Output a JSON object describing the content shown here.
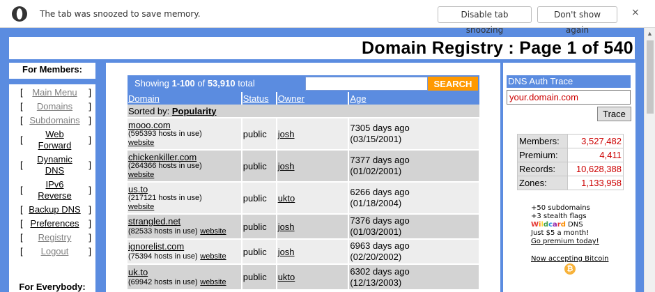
{
  "snooze_bar": {
    "message": "The tab was snoozed to save memory.",
    "disable_label": "Disable tab snoozing",
    "dont_show_label": "Don't show again",
    "close_glyph": "×"
  },
  "header": {
    "title": "Domain Registry : Page 1 of 540"
  },
  "sidebar": {
    "members_title": "For Members:",
    "everybody_title": "For Everybody:",
    "items": [
      {
        "label": "Main Menu"
      },
      {
        "label": "Domains"
      },
      {
        "label": "Subdomains"
      },
      {
        "label": "Web Forward"
      },
      {
        "label": "Dynamic DNS"
      },
      {
        "label": "IPv6 Reverse"
      },
      {
        "label": "Backup DNS"
      },
      {
        "label": "Preferences"
      },
      {
        "label": "Registry"
      },
      {
        "label": "Logout"
      }
    ]
  },
  "registry": {
    "showing_prefix": "Showing ",
    "range": "1-100",
    "of_label": " of ",
    "total": "53,910",
    "total_suffix": " total",
    "search_label": "SEARCH",
    "columns": [
      "Domain",
      "Status",
      "Owner",
      "Age"
    ],
    "sorted_by_label": "Sorted by: ",
    "sorted_by_value": "Popularity",
    "rows": [
      {
        "domain": "mooo.com",
        "hosts": "(595393 hosts in use)",
        "website": "website",
        "status": "public",
        "owner": "josh",
        "age": "7305 days ago",
        "date": "(03/15/2001)"
      },
      {
        "domain": "chickenkiller.com",
        "hosts": "(264366 hosts in use)",
        "website": "website",
        "status": "public",
        "owner": "josh",
        "age": "7377 days ago",
        "date": "(01/02/2001)"
      },
      {
        "domain": "us.to",
        "hosts": "(217121 hosts in use)",
        "website": "website",
        "status": "public",
        "owner": "ukto",
        "age": "6266 days ago",
        "date": "(01/18/2004)"
      },
      {
        "domain": "strangled.net",
        "hosts": "(82533 hosts in use)",
        "website": "website",
        "status": "public",
        "owner": "josh",
        "age": "7376 days ago",
        "date": "(01/03/2001)"
      },
      {
        "domain": "ignorelist.com",
        "hosts": "(75394 hosts in use)",
        "website": "website",
        "status": "public",
        "owner": "josh",
        "age": "6963 days ago",
        "date": "(02/20/2002)"
      },
      {
        "domain": "uk.to",
        "hosts": "(69942 hosts in use)",
        "website": "website",
        "status": "public",
        "owner": "ukto",
        "age": "6302 days ago",
        "date": "(12/13/2003)"
      }
    ]
  },
  "dns_trace": {
    "title": "DNS Auth Trace",
    "input_value": "your.domain.com",
    "button_label": "Trace"
  },
  "stats": [
    {
      "label": "Members:",
      "value": "3,527,482"
    },
    {
      "label": "Premium:",
      "value": "4,411"
    },
    {
      "label": "Records:",
      "value": "10,628,388"
    },
    {
      "label": "Zones:",
      "value": "1,133,958"
    }
  ],
  "promo": {
    "line1": "+50 subdomains",
    "line2": "+3 stealth flags",
    "wildcard_word": "Wildcard",
    "wildcard_rest": " DNS",
    "line4": "Just $5 a month!",
    "link": "Go premium today!",
    "bitcoin": "Now accepting Bitcoin"
  },
  "colors": {
    "page_blue": "#5b8ce0",
    "search_orange": "#ff9900",
    "stat_red": "#cc0000",
    "bitcoin_gold": "#f7b23a"
  }
}
